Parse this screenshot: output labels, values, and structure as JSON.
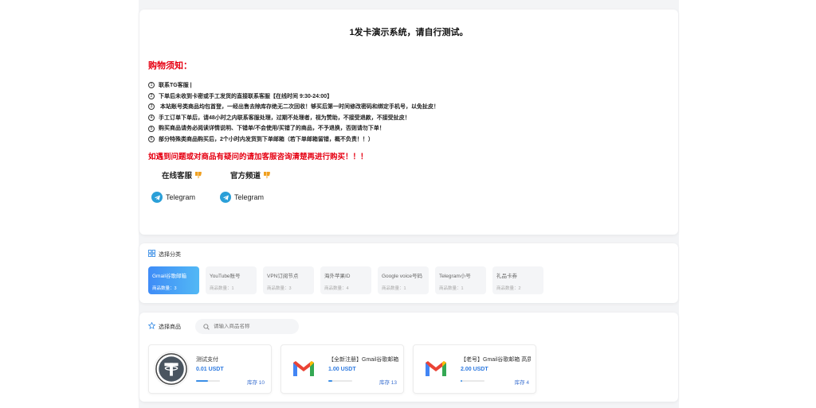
{
  "notice": {
    "title": "1发卡演示系统，请自行测试。",
    "heading": "购物须知：",
    "items": [
      {
        "num": "1",
        "text": "联系TG客服 |"
      },
      {
        "num": "2",
        "text": "下单后未收到卡密或手工发货的直接联系客服【在线时间 9:30-24:00】"
      },
      {
        "num": "3",
        "text": " 本站账号类商品均包首登，一经出售去除库存绝无二次回收！够买后第一时间修改密码和绑定手机号，以免扯皮！"
      },
      {
        "num": "4",
        "text": "手工订单下单后，请48小时之内联系客服处理，过期不处理者，视为赞助，不接受退款，不接受扯皮！"
      },
      {
        "num": "5",
        "text": "购买商品请务必阅读详情说明、下错单/不会使用/买错了的商品，不予退换，否则请勿下单！"
      },
      {
        "num": "6",
        "text": "部分特殊类商品购买后，2个小时内发货到下单邮箱（若下单邮箱留错，概不负责！！）"
      }
    ],
    "warning": "如遇到问题或对商品有疑问的请加客服咨询清楚再进行购买！！！",
    "online_service": "在线客服",
    "official_channel": "官方频道",
    "telegram1": "Telegram",
    "telegram2": "Telegram"
  },
  "category": {
    "title": "选择分类",
    "items": [
      {
        "name": "Gmail谷歌邮箱",
        "count": "商品数量：3",
        "active": true
      },
      {
        "name": "YouTube账号",
        "count": "商品数量：1",
        "active": false
      },
      {
        "name": "VPN订阅节点",
        "count": "商品数量：3",
        "active": false
      },
      {
        "name": "海外苹果ID",
        "count": "商品数量：4",
        "active": false
      },
      {
        "name": "Google voice号码",
        "count": "商品数量：1",
        "active": false
      },
      {
        "name": "Telegram小号",
        "count": "商品数量：1",
        "active": false
      },
      {
        "name": "礼品卡券",
        "count": "商品数量：2",
        "active": false
      }
    ]
  },
  "goods": {
    "title": "选择商品",
    "search_placeholder": "请输入商品名称",
    "items": [
      {
        "name": "测试支付",
        "price": "0.01 USDT",
        "stock": "库存 10",
        "icon": "tether-icon",
        "progress": 0.5
      },
      {
        "name": "【全新注册】Gmail谷歌邮箱",
        "price": "1.00 USDT",
        "stock": "库存 13",
        "icon": "gmail-icon",
        "progress": 0.15
      },
      {
        "name": "【老号】Gmail谷歌邮箱 高质量",
        "price": "2.00 USDT",
        "stock": "库存 4",
        "icon": "gmail-icon",
        "progress": 0.05
      }
    ]
  },
  "colors": {
    "accent": "#3f8cf7",
    "warning": "#e60012",
    "telegram": "#2a9fd8",
    "tether": "#26a17b"
  }
}
